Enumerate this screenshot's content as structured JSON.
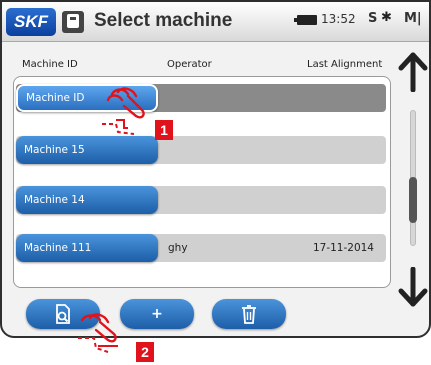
{
  "header": {
    "logo_text": "SKF",
    "title": "Select machine",
    "time": "13:52",
    "indicator_s": "S",
    "bluetooth_glyph": "✱",
    "indicator_m": "M|"
  },
  "columns": {
    "machine_id": "Machine ID",
    "operator": "Operator",
    "last_alignment": "Last Alignment"
  },
  "rows": [
    {
      "machine": "Machine ID",
      "operator": "",
      "date": "",
      "selected": true
    },
    {
      "machine": "Machine 15",
      "operator": "",
      "date": "",
      "selected": false
    },
    {
      "machine": "Machine 14",
      "operator": "",
      "date": "",
      "selected": false
    },
    {
      "machine": "Machine 111",
      "operator": "ghy",
      "date": "17-11-2014",
      "selected": false
    }
  ],
  "bottom_buttons": [
    {
      "icon": "open-file-icon",
      "label": ""
    },
    {
      "icon": "plus-icon",
      "label": "+"
    },
    {
      "icon": "trash-icon",
      "label": ""
    }
  ],
  "callouts": {
    "one": "1",
    "two": "2"
  },
  "colors": {
    "button_blue": "#1d5ea8",
    "selected_row": "#8a8a8a",
    "callout_red": "#e0131c"
  }
}
